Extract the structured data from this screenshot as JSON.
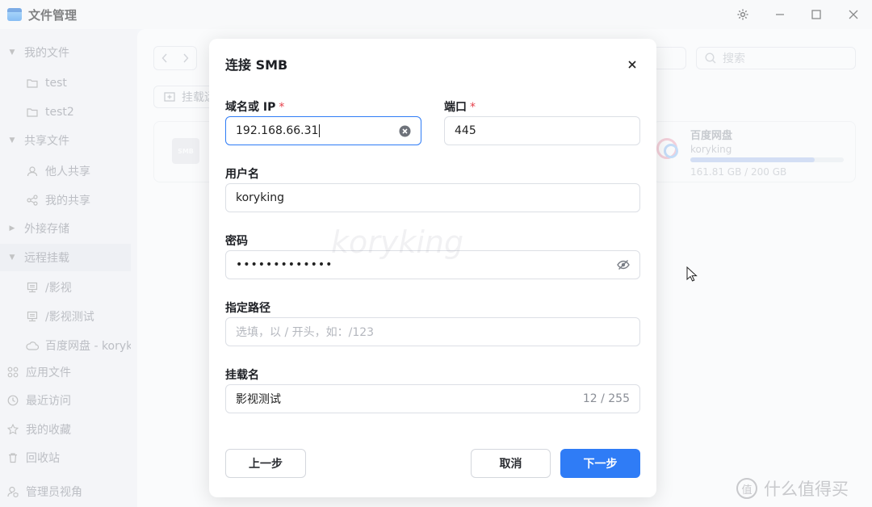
{
  "app": {
    "title": "文件管理"
  },
  "window_controls": {
    "settings_icon": "gear-icon",
    "minimize_icon": "minimize-icon",
    "maximize_icon": "maximize-icon",
    "close_icon": "close-icon"
  },
  "sidebar": {
    "items": [
      {
        "label": "我的文件",
        "icon": "caret-down"
      },
      {
        "label": "test",
        "icon": "folder-icon"
      },
      {
        "label": "test2",
        "icon": "folder-icon"
      },
      {
        "label": "共享文件",
        "icon": "caret-down"
      },
      {
        "label": "他人共享",
        "icon": "user-icon"
      },
      {
        "label": "我的共享",
        "icon": "share-icon"
      },
      {
        "label": "外接存储",
        "icon": "caret-right"
      },
      {
        "label": "远程挂载",
        "icon": "caret-down"
      },
      {
        "label": "/影视",
        "icon": "server-icon"
      },
      {
        "label": "/影视测试",
        "icon": "server-icon"
      },
      {
        "label": "百度网盘 - korykin",
        "icon": "cloud-icon"
      },
      {
        "label": "应用文件",
        "icon": "apps-icon"
      },
      {
        "label": "最近访问",
        "icon": "clock-icon"
      },
      {
        "label": "我的收藏",
        "icon": "star-icon"
      },
      {
        "label": "回收站",
        "icon": "trash-icon"
      },
      {
        "label": "管理员视角",
        "icon": "admin-icon"
      }
    ]
  },
  "background": {
    "search_placeholder": "搜索",
    "mount_button": "挂载远",
    "smb_card_icon": "SMB",
    "baidu_card": {
      "name": "百度网盘",
      "user": "koryking",
      "usage": "161.81 GB / 200 GB",
      "usage_fraction": 0.81
    }
  },
  "modal": {
    "title": "连接 SMB",
    "host": {
      "label": "域名或 IP",
      "required": "*",
      "value": "192.168.66.31"
    },
    "port": {
      "label": "端口",
      "required": "*",
      "value": "445"
    },
    "username": {
      "label": "用户名",
      "value": "koryking"
    },
    "password": {
      "label": "密码",
      "value": "•••••••••••••"
    },
    "path": {
      "label": "指定路径",
      "placeholder": "选填，以 / 开头，如：/123"
    },
    "mount_name": {
      "label": "挂载名",
      "value": "影视测试",
      "counter": "12 / 255"
    },
    "buttons": {
      "prev": "上一步",
      "cancel": "取消",
      "next": "下一步"
    }
  },
  "watermark": "koryking",
  "site_mark": {
    "icon": "值",
    "text": "什么值得买"
  }
}
